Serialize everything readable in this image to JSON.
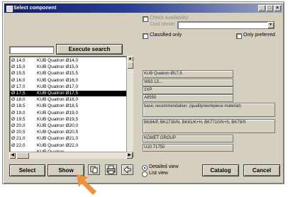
{
  "window": {
    "title": "Select component",
    "controls": [
      "_",
      "□",
      "×"
    ]
  },
  "filters": {
    "check_availability": "Check availability",
    "cost_center": "Cost center",
    "classified_only": "Classified only",
    "only_preferred": "Only preferred"
  },
  "search": {
    "value": "",
    "button": "Execute search"
  },
  "list": {
    "rows": [
      {
        "d": "Ø 14,0",
        "name": "KUB Quatron Ø14,0"
      },
      {
        "d": "Ø 15,0",
        "name": "KUB Quatron Ø15,0"
      },
      {
        "d": "Ø 15,5",
        "name": "KUB Quatron Ø15,5"
      },
      {
        "d": "Ø 16,0",
        "name": "KUB Quatron Ø16,0"
      },
      {
        "d": "Ø 17,0",
        "name": "KUB Quatron Ø17,0"
      },
      {
        "d": "Ø 17,5",
        "name": "KUB Quatron Ø17,5"
      },
      {
        "d": "Ø 18,0",
        "name": "KUB Quatron Ø18,0"
      },
      {
        "d": "Ø 18,5",
        "name": "KUB Quatron Ø18,5"
      },
      {
        "d": "Ø 19,0",
        "name": "KUB Quatron Ø19,0"
      },
      {
        "d": "Ø 19,5",
        "name": "KUB Quatron Ø19,5"
      },
      {
        "d": "Ø 20,0",
        "name": "KUB Quatron Ø20,0"
      },
      {
        "d": "Ø 20,5",
        "name": "KUB Quatron Ø20,5"
      },
      {
        "d": "Ø 21,0",
        "name": "KUB Quatron Ø21,0"
      },
      {
        "d": "Ø 22,0",
        "name": "KUB Quatron Ø22,0"
      },
      {
        "d": "",
        "name": "KUB Quatron"
      }
    ],
    "selected_index": 5
  },
  "details": {
    "name": "KUB Quatron Ø17,5",
    "code": "W83 13...",
    "type": "2XP",
    "number": "A8550",
    "recommendation": "basic recommendation: (quality/workpiece material)",
    "grades": "BK84/P, BK2730/N, BK61/K+H, BK7710/N+S, BK79/S",
    "manufacturer": "KOMET GROUP",
    "article": "U10 71750"
  },
  "view": {
    "detailed": "Detailed view",
    "list": "List view",
    "selected": "detailed"
  },
  "buttons": {
    "select": "Select",
    "show": "Show",
    "catalog": "Catalog",
    "cancel": "Cancel"
  },
  "colors": {
    "window_bg": "#d4cfbf",
    "titlebar": "#0d1f73",
    "pointer_arrow": "#f0913a"
  }
}
